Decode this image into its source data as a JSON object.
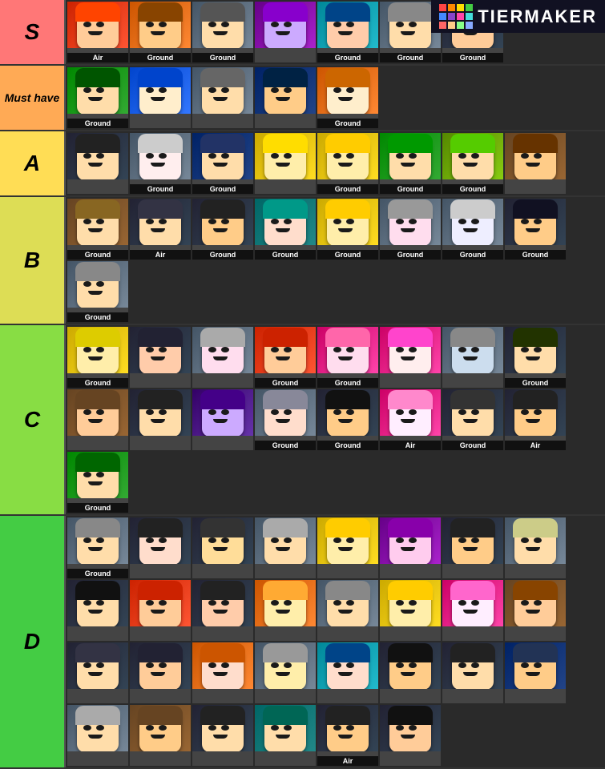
{
  "tiers": [
    {
      "id": "s",
      "label": "S",
      "colorClass": "tier-s",
      "characters": [
        {
          "bg": "bg-red",
          "label": "Air",
          "hairColor": "#ff4400",
          "skinColor": "#ffcc99"
        },
        {
          "bg": "bg-orange",
          "label": "Ground",
          "hairColor": "#884400",
          "skinColor": "#ffcc88"
        },
        {
          "bg": "bg-gray",
          "label": "Ground",
          "hairColor": "#555555",
          "skinColor": "#ffddaa"
        },
        {
          "bg": "bg-purple",
          "label": "",
          "hairColor": "#8800cc",
          "skinColor": "#ccaaff"
        },
        {
          "bg": "bg-cyan",
          "label": "Ground",
          "hairColor": "#004488",
          "skinColor": "#ffccaa"
        },
        {
          "bg": "bg-gray",
          "label": "Ground",
          "hairColor": "#888888",
          "skinColor": "#ffddaa"
        },
        {
          "bg": "bg-dark",
          "label": "Ground",
          "hairColor": "#222222",
          "skinColor": "#ffcc99"
        }
      ]
    },
    {
      "id": "musthave",
      "label": "Must have",
      "labelSize": "14px",
      "colorClass": "tier-musthave",
      "characters": [
        {
          "bg": "bg-green",
          "label": "Ground",
          "hairColor": "#005500",
          "skinColor": "#ffddaa"
        },
        {
          "bg": "bg-blue",
          "label": "",
          "hairColor": "#0044cc",
          "skinColor": "#ffeecc"
        },
        {
          "bg": "bg-gray",
          "label": "",
          "hairColor": "#666666",
          "skinColor": "#ffddaa"
        },
        {
          "bg": "bg-navy",
          "label": "",
          "hairColor": "#002244",
          "skinColor": "#ffcc88"
        },
        {
          "bg": "bg-orange",
          "label": "Ground",
          "hairColor": "#cc6600",
          "skinColor": "#ffeecc"
        }
      ]
    },
    {
      "id": "a",
      "label": "A",
      "colorClass": "tier-a",
      "characters": [
        {
          "bg": "bg-dark",
          "label": "",
          "hairColor": "#222222",
          "skinColor": "#ffddaa"
        },
        {
          "bg": "bg-gray",
          "label": "Ground",
          "hairColor": "#cccccc",
          "skinColor": "#ffeeee"
        },
        {
          "bg": "bg-navy",
          "label": "Ground",
          "hairColor": "#223366",
          "skinColor": "#ffddaa"
        },
        {
          "bg": "bg-yellow",
          "label": "",
          "hairColor": "#ffdd00",
          "skinColor": "#ffeeaa"
        },
        {
          "bg": "bg-yellow",
          "label": "Ground",
          "hairColor": "#ffcc00",
          "skinColor": "#ffeeaa"
        },
        {
          "bg": "bg-green",
          "label": "Ground",
          "hairColor": "#009900",
          "skinColor": "#ffddaa"
        },
        {
          "bg": "bg-lime",
          "label": "Ground",
          "hairColor": "#55cc00",
          "skinColor": "#ffddaa"
        },
        {
          "bg": "bg-brown",
          "label": "",
          "hairColor": "#663300",
          "skinColor": "#ffcc88"
        }
      ]
    },
    {
      "id": "b",
      "label": "B",
      "colorClass": "tier-b",
      "characters": [
        {
          "bg": "bg-brown",
          "label": "Ground",
          "hairColor": "#886622",
          "skinColor": "#ffddaa"
        },
        {
          "bg": "bg-dark",
          "label": "Air",
          "hairColor": "#333344",
          "skinColor": "#ffddaa"
        },
        {
          "bg": "bg-dark",
          "label": "Ground",
          "hairColor": "#222222",
          "skinColor": "#ffcc88"
        },
        {
          "bg": "bg-teal",
          "label": "Ground",
          "hairColor": "#009988",
          "skinColor": "#ffddcc"
        },
        {
          "bg": "bg-yellow",
          "label": "Ground",
          "hairColor": "#ffcc00",
          "skinColor": "#ffeeaa"
        },
        {
          "bg": "bg-gray",
          "label": "Ground",
          "hairColor": "#999999",
          "skinColor": "#ffddee"
        },
        {
          "bg": "bg-gray",
          "label": "Ground",
          "hairColor": "#cccccc",
          "skinColor": "#eeeeff"
        },
        {
          "bg": "bg-dark",
          "label": "Ground",
          "hairColor": "#111122",
          "skinColor": "#ffcc88"
        },
        {
          "bg": "bg-gray",
          "label": "Ground",
          "hairColor": "#888888",
          "skinColor": "#ffddaa"
        }
      ]
    },
    {
      "id": "c",
      "label": "C",
      "colorClass": "tier-c",
      "characters": [
        {
          "bg": "bg-yellow",
          "label": "Ground",
          "hairColor": "#ddcc00",
          "skinColor": "#ffeeaa"
        },
        {
          "bg": "bg-dark",
          "label": "",
          "hairColor": "#222233",
          "skinColor": "#ffccaa"
        },
        {
          "bg": "bg-gray",
          "label": "",
          "hairColor": "#aaaaaa",
          "skinColor": "#ffddee"
        },
        {
          "bg": "bg-red",
          "label": "Ground",
          "hairColor": "#cc2200",
          "skinColor": "#ffcc99"
        },
        {
          "bg": "bg-pink",
          "label": "Ground",
          "hairColor": "#ff66aa",
          "skinColor": "#ffddee"
        },
        {
          "bg": "bg-pink",
          "label": "",
          "hairColor": "#ff44cc",
          "skinColor": "#ffeeee"
        },
        {
          "bg": "bg-gray",
          "label": "",
          "hairColor": "#888888",
          "skinColor": "#ccddee"
        },
        {
          "bg": "bg-dark",
          "label": "Ground",
          "hairColor": "#223300",
          "skinColor": "#ffddaa"
        },
        {
          "bg": "bg-brown",
          "label": "",
          "hairColor": "#664422",
          "skinColor": "#ffcc99"
        },
        {
          "bg": "bg-dark",
          "label": "",
          "hairColor": "#222222",
          "skinColor": "#ffddaa"
        },
        {
          "bg": "bg-indigo",
          "label": "",
          "hairColor": "#440088",
          "skinColor": "#ccaaff"
        },
        {
          "bg": "bg-gray",
          "label": "Ground",
          "hairColor": "#888899",
          "skinColor": "#ffddcc"
        },
        {
          "bg": "bg-dark",
          "label": "Ground",
          "hairColor": "#111111",
          "skinColor": "#ffcc88"
        },
        {
          "bg": "bg-pink",
          "label": "Air",
          "hairColor": "#ff88cc",
          "skinColor": "#ffeeff"
        },
        {
          "bg": "bg-dark",
          "label": "Ground",
          "hairColor": "#333333",
          "skinColor": "#ffddaa"
        },
        {
          "bg": "bg-dark",
          "label": "Air",
          "hairColor": "#222222",
          "skinColor": "#ffcc88"
        },
        {
          "bg": "bg-green",
          "label": "Ground",
          "hairColor": "#006600",
          "skinColor": "#ffddaa"
        }
      ]
    },
    {
      "id": "d",
      "label": "D",
      "colorClass": "tier-d",
      "characters": [
        {
          "bg": "bg-gray",
          "label": "Ground",
          "hairColor": "#888888",
          "skinColor": "#ffddaa"
        },
        {
          "bg": "bg-dark",
          "label": "",
          "hairColor": "#222222",
          "skinColor": "#ffddcc"
        },
        {
          "bg": "bg-dark",
          "label": "",
          "hairColor": "#333333",
          "skinColor": "#ffdd99"
        },
        {
          "bg": "bg-gray",
          "label": "",
          "hairColor": "#aaaaaa",
          "skinColor": "#ffddaa"
        },
        {
          "bg": "bg-yellow",
          "label": "",
          "hairColor": "#ffcc00",
          "skinColor": "#ffeeaa"
        },
        {
          "bg": "bg-purple",
          "label": "",
          "hairColor": "#8800aa",
          "skinColor": "#ffccee"
        },
        {
          "bg": "bg-dark",
          "label": "",
          "hairColor": "#222222",
          "skinColor": "#ffcc88"
        },
        {
          "bg": "bg-gray",
          "label": "",
          "hairColor": "#cccc88",
          "skinColor": "#ffddaa"
        },
        {
          "bg": "bg-dark",
          "label": "",
          "hairColor": "#111111",
          "skinColor": "#ffddaa"
        },
        {
          "bg": "bg-red",
          "label": "",
          "hairColor": "#cc2200",
          "skinColor": "#ffcc99"
        },
        {
          "bg": "bg-dark",
          "label": "",
          "hairColor": "#222222",
          "skinColor": "#ffccaa"
        },
        {
          "bg": "bg-orange",
          "label": "",
          "hairColor": "#ffaa33",
          "skinColor": "#ffeeaa"
        },
        {
          "bg": "bg-gray",
          "label": "",
          "hairColor": "#888888",
          "skinColor": "#ffddaa"
        },
        {
          "bg": "bg-yellow",
          "label": "",
          "hairColor": "#ffcc00",
          "skinColor": "#ffeeaa"
        },
        {
          "bg": "bg-pink",
          "label": "",
          "hairColor": "#ff66cc",
          "skinColor": "#ffeeff"
        },
        {
          "bg": "bg-brown",
          "label": "",
          "hairColor": "#884400",
          "skinColor": "#ffcc99"
        },
        {
          "bg": "bg-dark",
          "label": "",
          "hairColor": "#333344",
          "skinColor": "#ffddaa"
        },
        {
          "bg": "bg-dark",
          "label": "",
          "hairColor": "#222233",
          "skinColor": "#ffcc99"
        },
        {
          "bg": "bg-orange",
          "label": "",
          "hairColor": "#cc5500",
          "skinColor": "#ffddcc"
        },
        {
          "bg": "bg-gray",
          "label": "",
          "hairColor": "#999999",
          "skinColor": "#ffeeaa"
        },
        {
          "bg": "bg-cyan",
          "label": "",
          "hairColor": "#004488",
          "skinColor": "#ffddcc"
        },
        {
          "bg": "bg-dark",
          "label": "",
          "hairColor": "#111111",
          "skinColor": "#ffcc88"
        },
        {
          "bg": "bg-dark",
          "label": "",
          "hairColor": "#222222",
          "skinColor": "#ffddaa"
        },
        {
          "bg": "bg-navy",
          "label": "",
          "hairColor": "#223355",
          "skinColor": "#ffcc88"
        },
        {
          "bg": "bg-gray",
          "label": "",
          "hairColor": "#aaaaaa",
          "skinColor": "#ffddaa"
        },
        {
          "bg": "bg-brown",
          "label": "",
          "hairColor": "#664422",
          "skinColor": "#ffcc88"
        },
        {
          "bg": "bg-dark",
          "label": "",
          "hairColor": "#222222",
          "skinColor": "#ffddaa"
        },
        {
          "bg": "bg-teal",
          "label": "",
          "hairColor": "#006655",
          "skinColor": "#ffddaa"
        },
        {
          "bg": "bg-dark",
          "label": "Air",
          "hairColor": "#222222",
          "skinColor": "#ffcc88"
        },
        {
          "bg": "bg-dark",
          "label": "",
          "hairColor": "#111111",
          "skinColor": "#ffcc99"
        }
      ]
    }
  ],
  "logo": {
    "text": "TIERMAKER",
    "colors": [
      "#ff4444",
      "#ff8800",
      "#ffdd00",
      "#44cc44",
      "#4488ff",
      "#8844cc",
      "#ff44aa",
      "#44dddd",
      "#ffaaaa",
      "#ffcc88",
      "#88ff88",
      "#88aaff"
    ]
  }
}
